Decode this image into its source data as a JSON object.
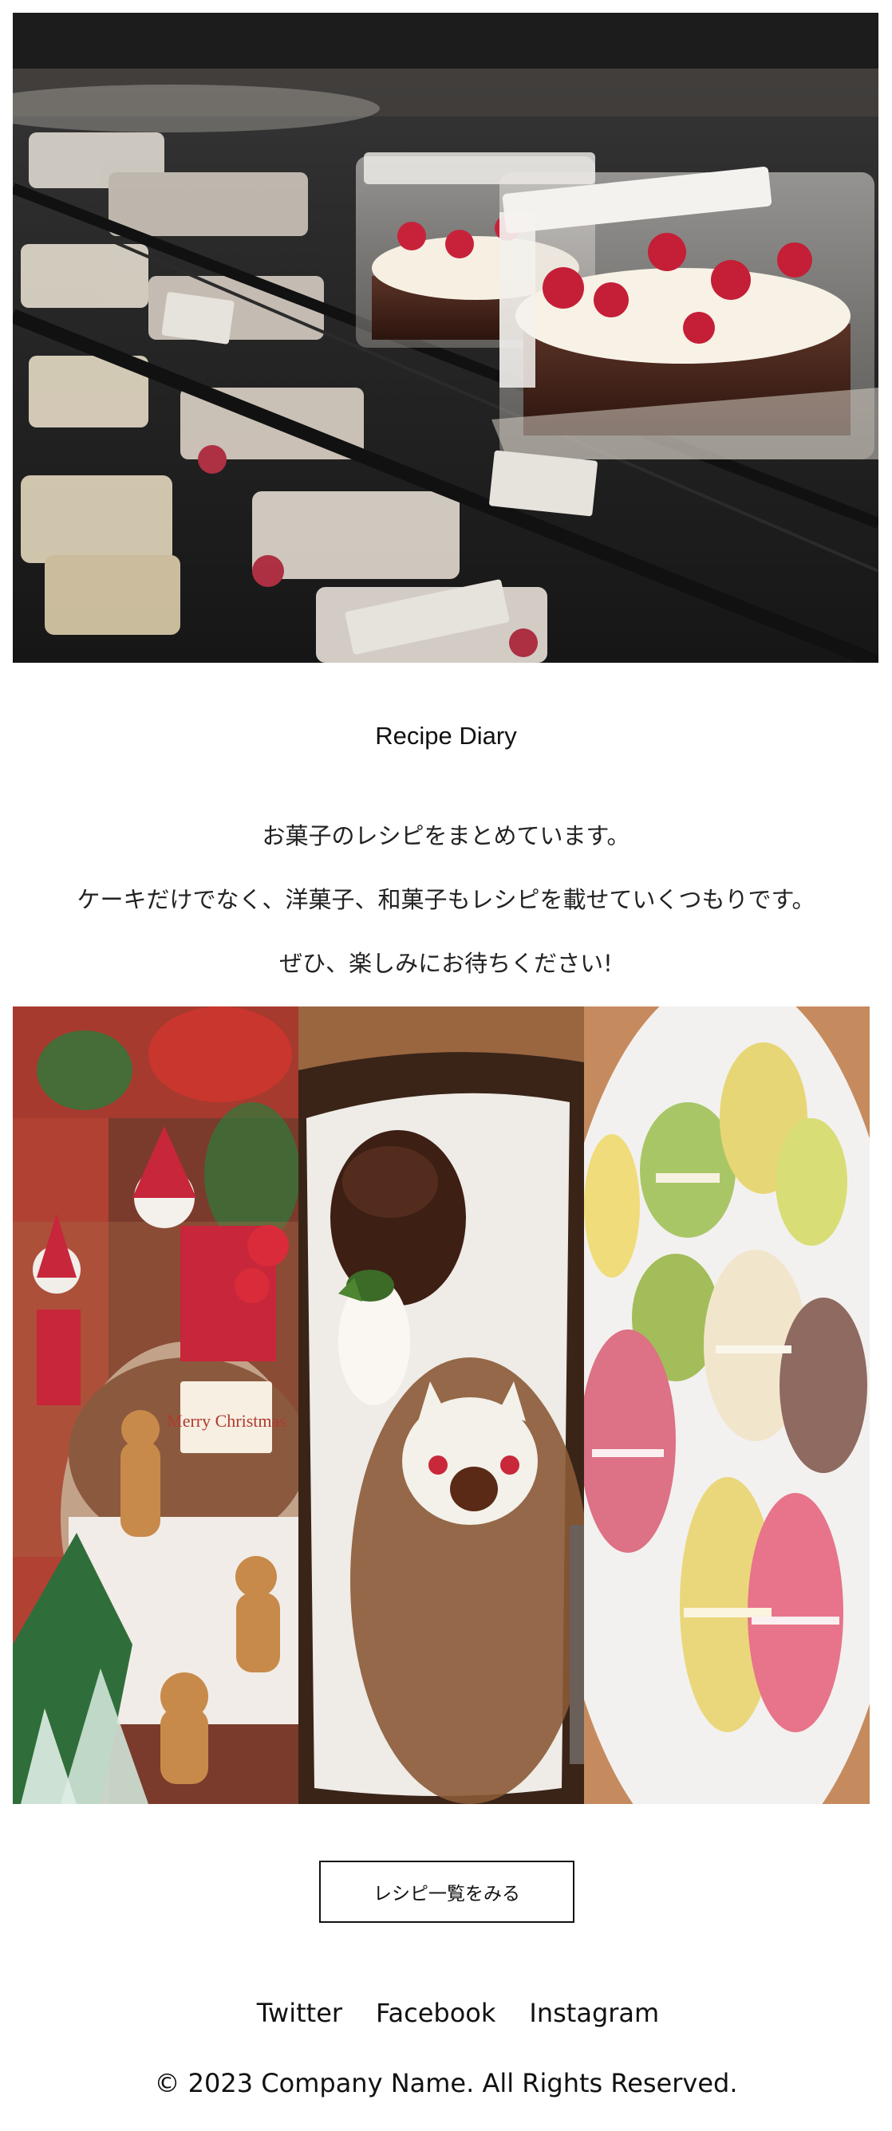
{
  "hero": {
    "image": "cake-display-case-photo"
  },
  "site": {
    "title": "Recipe Diary"
  },
  "intro": {
    "lines": [
      "お菓子のレシピをまとめています。",
      "ケーキだけでなく、洋菓子、和菓子もレシピを載せていくつもりです。",
      "ぜひ、楽しみにお待ちください!"
    ]
  },
  "gallery": {
    "photos": [
      "christmas-cake-photo",
      "chocolate-fondant-photo",
      "macarons-photo"
    ],
    "christmas_plaque": "Merry Christmas"
  },
  "cta": {
    "label": "レシピ一覧をみる"
  },
  "social": {
    "links": [
      "Twitter",
      "Facebook",
      "Instagram"
    ]
  },
  "footer": {
    "copyright": "© 2023 Company Name. All Rights Reserved."
  }
}
